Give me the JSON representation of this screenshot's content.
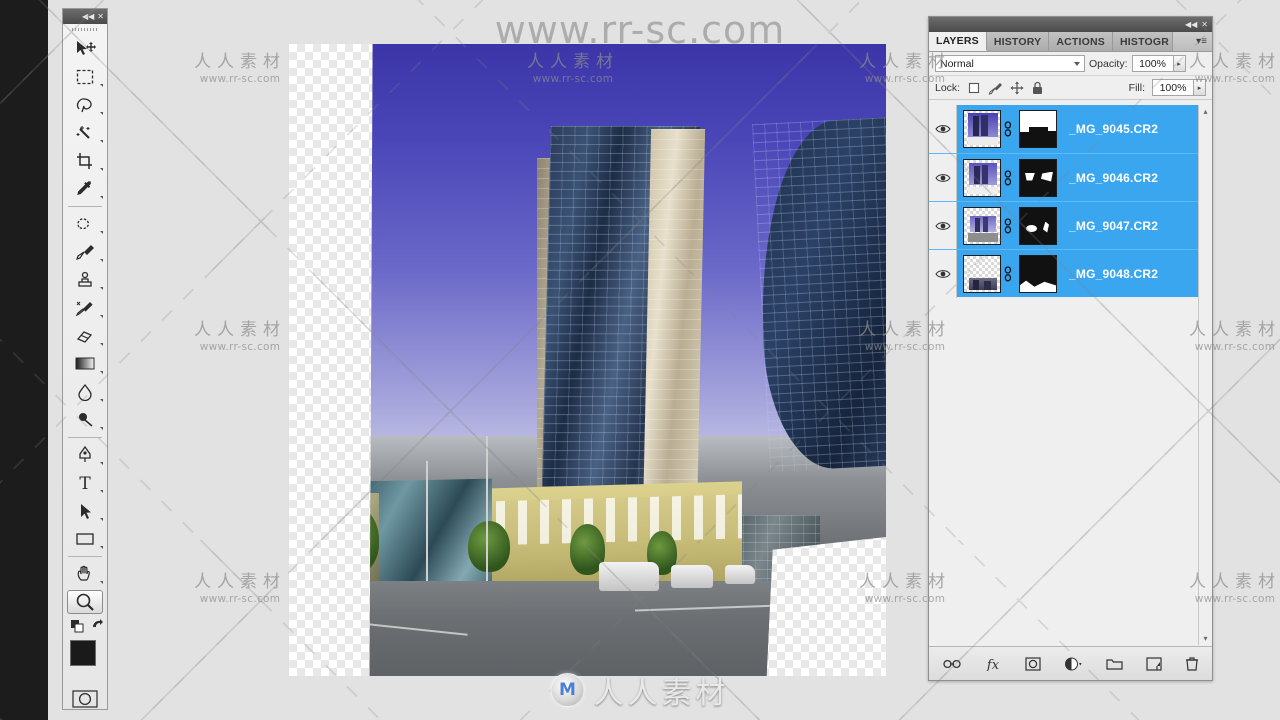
{
  "app": {
    "toolbar": {
      "collapse_label": "◀◀",
      "close_label": "✕",
      "tools": [
        {
          "name": "move-tool",
          "title": "Move Tool"
        },
        {
          "name": "rectangular-marquee-tool",
          "title": "Rectangular Marquee Tool"
        },
        {
          "name": "lasso-tool",
          "title": "Lasso Tool"
        },
        {
          "name": "magic-wand-tool",
          "title": "Magic Wand Tool"
        },
        {
          "name": "crop-tool",
          "title": "Crop Tool"
        },
        {
          "name": "eyedropper-tool",
          "title": "Eyedropper Tool"
        },
        {
          "name": "healing-brush-tool",
          "title": "Spot Healing Brush Tool"
        },
        {
          "name": "brush-tool",
          "title": "Brush Tool"
        },
        {
          "name": "clone-stamp-tool",
          "title": "Clone Stamp Tool"
        },
        {
          "name": "history-brush-tool",
          "title": "History Brush Tool"
        },
        {
          "name": "eraser-tool",
          "title": "Eraser Tool"
        },
        {
          "name": "gradient-tool",
          "title": "Gradient Tool"
        },
        {
          "name": "blur-tool",
          "title": "Blur Tool"
        },
        {
          "name": "dodge-tool",
          "title": "Dodge Tool"
        },
        {
          "name": "pen-tool",
          "title": "Pen Tool"
        },
        {
          "name": "type-tool",
          "title": "Horizontal Type Tool"
        },
        {
          "name": "path-selection-tool",
          "title": "Path Selection Tool"
        },
        {
          "name": "rectangle-tool",
          "title": "Rectangle Tool"
        },
        {
          "name": "hand-tool",
          "title": "Hand Tool"
        },
        {
          "name": "zoom-tool",
          "title": "Zoom Tool",
          "active": true
        }
      ],
      "foreground_color": "#1a1a1a",
      "background_color": "#ffffff",
      "quick_mask_title": "Edit in Quick Mask Mode"
    },
    "layers_panel": {
      "collapse_label": "◀◀",
      "close_label": "✕",
      "menu_label": "▾≡",
      "tabs": [
        {
          "label": "LAYERS",
          "active": true
        },
        {
          "label": "HISTORY",
          "active": false
        },
        {
          "label": "ACTIONS",
          "active": false
        },
        {
          "label": "HISTOGR",
          "active": false
        }
      ],
      "blend_mode": "Normal",
      "opacity_label": "Opacity:",
      "opacity_value": "100%",
      "fill_label": "Fill:",
      "fill_value": "100%",
      "lock_label": "Lock:",
      "lock_items": [
        {
          "name": "lock-transparent-pixels-icon",
          "title": "Lock transparent pixels"
        },
        {
          "name": "lock-image-pixels-icon",
          "title": "Lock image pixels"
        },
        {
          "name": "lock-position-icon",
          "title": "Lock position"
        },
        {
          "name": "lock-all-icon",
          "title": "Lock all"
        }
      ],
      "layers": [
        {
          "name": "_MG_9045.CR2",
          "visible": true,
          "selected": true,
          "mask": "top-white"
        },
        {
          "name": "_MG_9046.CR2",
          "visible": true,
          "selected": true,
          "mask": "two-blobs"
        },
        {
          "name": "_MG_9047.CR2",
          "visible": true,
          "selected": true,
          "mask": "small-blobs"
        },
        {
          "name": "_MG_9048.CR2",
          "visible": true,
          "selected": true,
          "mask": "bottom-white"
        }
      ],
      "selection_color": "#3aa6f0",
      "bottom_buttons": [
        {
          "name": "link-layers-button",
          "title": "Link layers"
        },
        {
          "name": "layer-style-button",
          "title": "Add a layer style",
          "label": "fx"
        },
        {
          "name": "add-layer-mask-button",
          "title": "Add layer mask"
        },
        {
          "name": "new-adjustment-layer-button",
          "title": "Create new fill or adjustment layer"
        },
        {
          "name": "new-group-button",
          "title": "Create a new group"
        },
        {
          "name": "new-layer-button",
          "title": "Create a new layer"
        },
        {
          "name": "delete-layer-button",
          "title": "Delete layer"
        }
      ],
      "scroll_up": "▴",
      "scroll_down": "▾"
    },
    "canvas": {
      "title": "building-photo-composite",
      "description": "High-rise building photograph with transparency checkerboard edges"
    },
    "watermarks": {
      "top": "www.rr-sc.com",
      "cn_text": "人人素材",
      "cn_url": "www.rr-sc.com",
      "bottom_text": "人人素材",
      "logo_glyph": "M"
    }
  }
}
